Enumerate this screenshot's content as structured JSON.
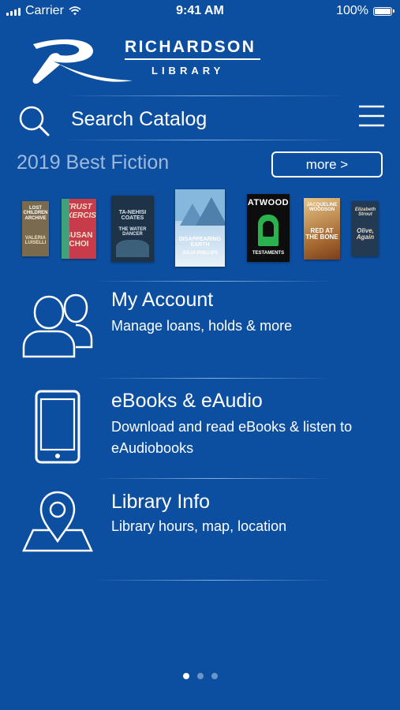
{
  "status_bar": {
    "carrier": "Carrier",
    "time": "9:41 AM",
    "battery": "100%"
  },
  "logo": {
    "title": "RICHARDSON",
    "subtitle": "LIBRARY"
  },
  "search": {
    "placeholder": "Search Catalog"
  },
  "featured": {
    "title": "2019 Best Fiction",
    "more_label": "more >",
    "books": [
      {
        "text": "LOST CHILDREN ARCHIVE VALERIA LUISELLI",
        "color": "#7a6a4e"
      },
      {
        "text": "TRUST EXERCISE SUSAN CHOI",
        "color": "#c73b4a"
      },
      {
        "text": "TA-NEHISI COATES THE WATER DANCER",
        "color": "#1e3348"
      },
      {
        "text": "DISAPPEARING EARTH JULIA PHILLIPS",
        "color": "#86b8de"
      },
      {
        "text": "ATWOOD THE TESTAMENTS",
        "color": "#0d0d0d"
      },
      {
        "text": "JACQUELINE WOODSON RED AT THE BONE",
        "color": "#c9a46a"
      },
      {
        "text": "Elizabeth Strout Olive, Again",
        "color": "#233a52"
      }
    ]
  },
  "menu": [
    {
      "title": "My Account",
      "description": "Manage loans, holds & more",
      "icon": "users-icon"
    },
    {
      "title": "eBooks & eAudio",
      "description": "Download and read eBooks & listen to eAudiobooks",
      "icon": "phone-icon"
    },
    {
      "title": "Library Info",
      "description": "Library hours, map, location",
      "icon": "map-pin-icon"
    }
  ],
  "pager": {
    "count": 3,
    "active_index": 0
  }
}
